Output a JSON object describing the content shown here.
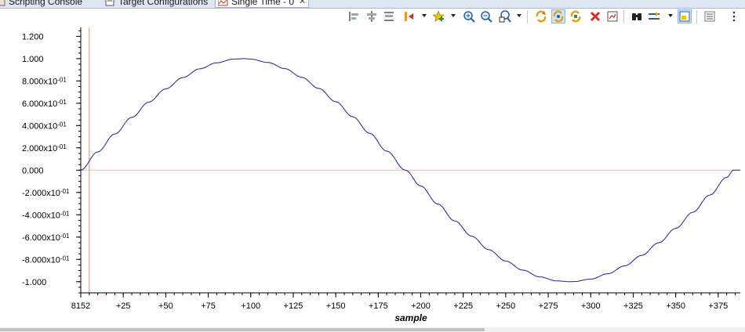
{
  "tabs": [
    {
      "label": "Scripting Console",
      "icon": "console-icon",
      "active": false
    },
    {
      "label": "Target Configurations",
      "icon": "target-config-icon",
      "active": false
    },
    {
      "label": "Single Time - 0",
      "icon": "graph-icon",
      "active": true
    }
  ],
  "toolbar": {
    "icons": [
      "align-left-icon",
      "align-center-icon",
      "align-right-icon",
      "import-icon",
      "add-measurement-icon",
      "zoom-in-icon",
      "zoom-out-icon",
      "zoom-fit-icon",
      "refresh-icon",
      "continuous-refresh-icon",
      "auto-scale-icon",
      "remove-icon",
      "export-icon",
      "binoculars-icon",
      "display-properties-icon",
      "floating-view-icon",
      "legend-icon",
      "view-menu-icon"
    ]
  },
  "chart_data": {
    "type": "line",
    "title": "",
    "xlabel": "sample",
    "ylabel": "",
    "x_tick_labels": [
      "8152",
      "+25",
      "+50",
      "+75",
      "+100",
      "+125",
      "+150",
      "+175",
      "+200",
      "+225",
      "+250",
      "+275",
      "+300",
      "+325",
      "+350",
      "+375"
    ],
    "x_tick_values": [
      0,
      25,
      50,
      75,
      100,
      125,
      150,
      175,
      200,
      225,
      250,
      275,
      300,
      325,
      350,
      375
    ],
    "y_tick_labels": [
      "1.200",
      "1.000",
      "8.000x10-01",
      "6.000x10-01",
      "4.000x10-01",
      "2.000x10-01",
      "0.000",
      "-2.000x10-01",
      "-4.000x10-01",
      "-6.000x10-01",
      "-8.000x10-01",
      "-1.000"
    ],
    "y_tick_values": [
      1.2,
      1.0,
      0.8,
      0.6,
      0.4,
      0.2,
      0.0,
      -0.2,
      -0.4,
      -0.6,
      -0.8,
      -1.0
    ],
    "xlim": [
      0,
      388
    ],
    "ylim": [
      -1.1,
      1.28
    ],
    "series": [
      {
        "color": "#1f1f9e",
        "x": [
          0,
          10,
          20,
          30,
          40,
          50,
          60,
          70,
          80,
          90,
          96,
          100,
          110,
          120,
          130,
          140,
          150,
          160,
          170,
          180,
          191,
          200,
          210,
          220,
          230,
          240,
          250,
          260,
          270,
          280,
          288,
          290,
          300,
          310,
          320,
          330,
          340,
          350,
          360,
          370,
          380,
          384,
          388
        ],
        "y": [
          0.0,
          0.164,
          0.324,
          0.473,
          0.61,
          0.729,
          0.83,
          0.909,
          0.963,
          0.996,
          1.0,
          0.996,
          0.966,
          0.911,
          0.833,
          0.733,
          0.614,
          0.479,
          0.33,
          0.171,
          0.0,
          -0.142,
          -0.303,
          -0.455,
          -0.592,
          -0.713,
          -0.815,
          -0.896,
          -0.957,
          -0.993,
          -1.0,
          -0.999,
          -0.977,
          -0.929,
          -0.858,
          -0.764,
          -0.651,
          -0.522,
          -0.378,
          -0.224,
          -0.064,
          0.0,
          0.0
        ]
      }
    ],
    "cursor_x": 5,
    "zero_line_color": "#f4c0b0",
    "cursor_color": "#f08a7a"
  }
}
